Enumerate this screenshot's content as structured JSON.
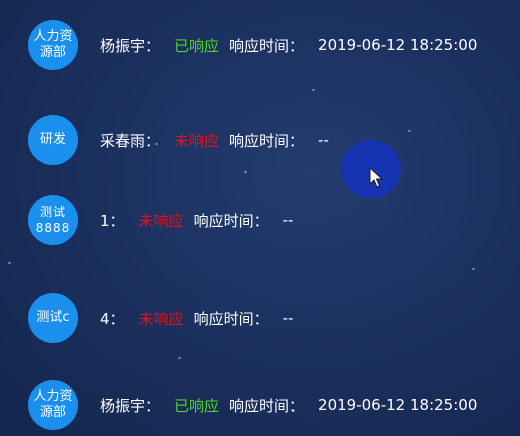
{
  "rows": [
    {
      "dept": "人力资源部",
      "name": "杨振宇：",
      "status": "已响应",
      "status_type": "ok",
      "resp_label": "响应时间：",
      "resp_time": "2019-06-12 18:25:00"
    },
    {
      "dept": "研发",
      "name": "采春雨：",
      "status": "未响应",
      "status_type": "no",
      "resp_label": "响应时间：",
      "resp_time": "--"
    },
    {
      "dept": "测试8888",
      "name": "1：",
      "status": "未响应",
      "status_type": "no",
      "resp_label": "响应时间：",
      "resp_time": "--"
    },
    {
      "dept": "测试c",
      "name": "4：",
      "status": "未响应",
      "status_type": "no",
      "resp_label": "响应时间：",
      "resp_time": "--"
    },
    {
      "dept": "人力资源部",
      "name": "杨振宇：",
      "status": "已响应",
      "status_type": "ok",
      "resp_label": "响应时间：",
      "resp_time": "2019-06-12 18:25:00"
    }
  ],
  "colors": {
    "circle": "#1a8fee",
    "responded": "#54d22a",
    "not_responded": "#e0121a",
    "background": "#1b3160"
  },
  "icons": {
    "cursor": "mouse-pointer-icon"
  }
}
